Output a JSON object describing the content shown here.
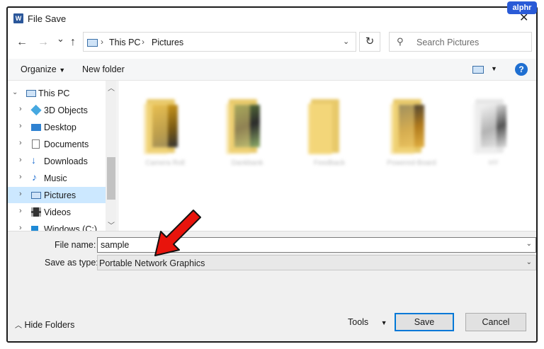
{
  "window": {
    "title": "File Save",
    "close_glyph": "✕",
    "app_icon_letter": "W"
  },
  "watermark": "alphr",
  "nav": {
    "back": "←",
    "forward": "→",
    "recent": "⌄",
    "up": "↑",
    "breadcrumb": [
      "This PC",
      "Pictures"
    ],
    "refresh": "↻",
    "search_placeholder": "Search Pictures"
  },
  "toolbar": {
    "organize": "Organize",
    "new_folder": "New folder",
    "help": "?"
  },
  "sidebar": {
    "items": [
      {
        "label": "This PC",
        "icon": "pc-icon"
      },
      {
        "label": "3D Objects",
        "icon": "3d-objects-icon"
      },
      {
        "label": "Desktop",
        "icon": "desktop-icon"
      },
      {
        "label": "Documents",
        "icon": "documents-icon"
      },
      {
        "label": "Downloads",
        "icon": "downloads-icon"
      },
      {
        "label": "Music",
        "icon": "music-icon"
      },
      {
        "label": "Pictures",
        "icon": "pictures-icon",
        "selected": true
      },
      {
        "label": "Videos",
        "icon": "videos-icon"
      },
      {
        "label": "Windows (C:)",
        "icon": "drive-icon"
      }
    ]
  },
  "folders": [
    {
      "name": "Camera Roll"
    },
    {
      "name": "Dankbank"
    },
    {
      "name": "Feedback"
    },
    {
      "name": "Powered-Board"
    },
    {
      "name": "HY"
    }
  ],
  "form": {
    "file_name_label": "File name:",
    "file_name_value": "sample",
    "save_as_label": "Save as type:",
    "save_as_value": "Portable Network Graphics"
  },
  "footer": {
    "hide_folders": "Hide Folders",
    "tools": "Tools",
    "save": "Save",
    "cancel": "Cancel"
  },
  "colors": {
    "accent": "#0078d7",
    "selection": "#cce8ff",
    "arrow": "#e8140c",
    "watermark_bg": "#2a5bd7"
  }
}
